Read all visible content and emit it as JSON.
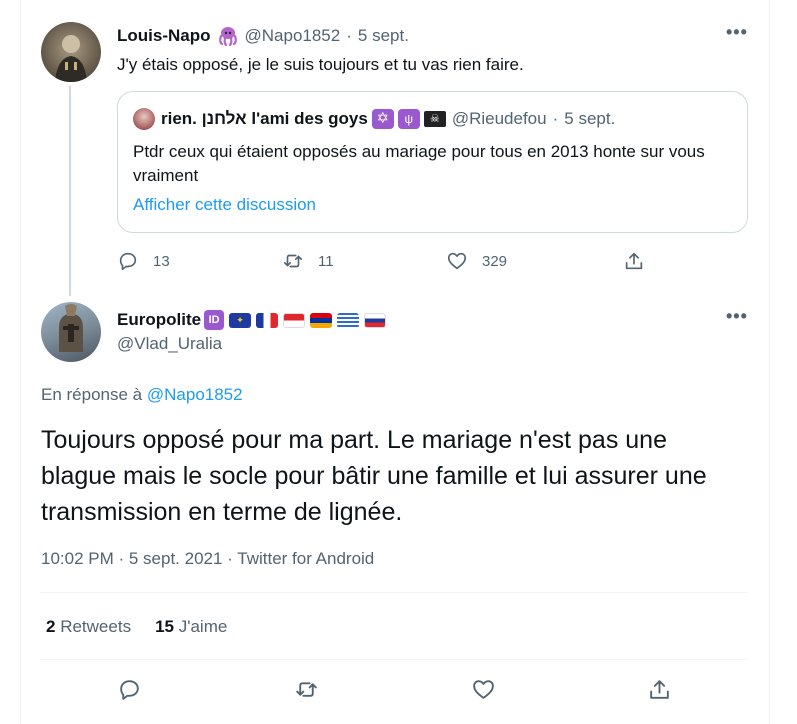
{
  "tweet1": {
    "display_name": "Louis-Napo",
    "emoji": "octopus-emoji",
    "handle": "@Napo1852",
    "dot": "·",
    "date": "5 sept.",
    "text": "J'y étais opposé, je le suis toujours et tu vas rien faire.",
    "quote": {
      "display_name": "rien. אלחנן l'ami des goys",
      "handle": "@Rieudefou",
      "dot": "·",
      "date": "5 sept.",
      "text": "Ptdr ceux qui étaient opposés au mariage pour tous en 2013 honte sur vous vraiment",
      "show_thread": "Afficher cette discussion"
    },
    "actions": {
      "reply_count": "13",
      "retweet_count": "11",
      "like_count": "329"
    }
  },
  "tweet2": {
    "display_name": "Europolite",
    "handle": "@Vlad_Uralia",
    "reply_prefix": "En réponse à",
    "reply_to": "@Napo1852",
    "text": "Toujours opposé pour ma part. Le mariage n'est pas une blague mais le socle pour bâtir une famille et lui assurer une transmission en terme de lignée.",
    "meta": "10:02 PM · 5 sept. 2021 · Twitter for Android",
    "stats": {
      "retweets_count": "2",
      "retweets_label": "Retweets",
      "likes_count": "15",
      "likes_label": "J'aime"
    }
  },
  "colors": {
    "accent": "#1d9bf0",
    "muted": "#536471",
    "border": "#cfd9de"
  }
}
